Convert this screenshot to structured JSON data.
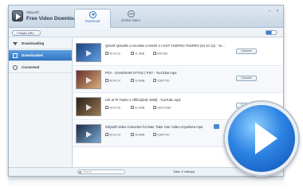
{
  "titlebar": {
    "brand": "iSkysoft",
    "app_title": "Free Video Downloader",
    "tabs": [
      {
        "label": "Download",
        "icon": "download-circle-icon",
        "active": true
      },
      {
        "label": "Online Video",
        "icon": "globe-icon",
        "active": false
      }
    ],
    "window_controls": [
      "–",
      "×"
    ]
  },
  "toolbar": {
    "paste_label": "+ Paste URL"
  },
  "sidebar": {
    "items": [
      {
        "label": "Downloading",
        "icon": "download-arrow-icon",
        "active": false
      },
      {
        "label": "Downloaded",
        "icon": "film-icon",
        "active": true
      },
      {
        "label": "Converted",
        "icon": "convert-icon",
        "active": false
      }
    ]
  },
  "videos": [
    {
      "title": "QOUR QOURE CAGANIE CANOR 3 Ⅰ HOT  TKEPRO  TKEPRO (04 10 12) - Yo...",
      "duration": "00:03:20",
      "size": "11.9MB",
      "resolution": "640*360",
      "has_convert": true,
      "converted": false
    },
    {
      "title": "PSY - GANGNAM STYLE ( PSY - YouTube.mp4",
      "duration": "00:04:12",
      "size": "19.6MB",
      "resolution": "1280*720",
      "has_convert": true,
      "converted": false
    },
    {
      "title": "Life of Pi Trailer 2 Official[HD 1080] - YouTube.mp4",
      "duration": "00:02:30",
      "size": "41.9MB",
      "resolution": "1920*1080",
      "has_convert": true,
      "converted": true
    },
    {
      "title": "iSkysoft Video Converter for Mac: Take Your Video Anywhere.mp4",
      "duration": "00:01:23",
      "size": "16.8MB",
      "resolution": "1280*720",
      "has_convert": false,
      "converted": false
    }
  ],
  "convert_label": "Convert",
  "status": {
    "search_placeholder": "Search",
    "total": "Total: 4 Video(s)"
  },
  "colors": {
    "accent": "#2f74c2",
    "success": "#52a84a",
    "play_button": "#2e84e3"
  }
}
